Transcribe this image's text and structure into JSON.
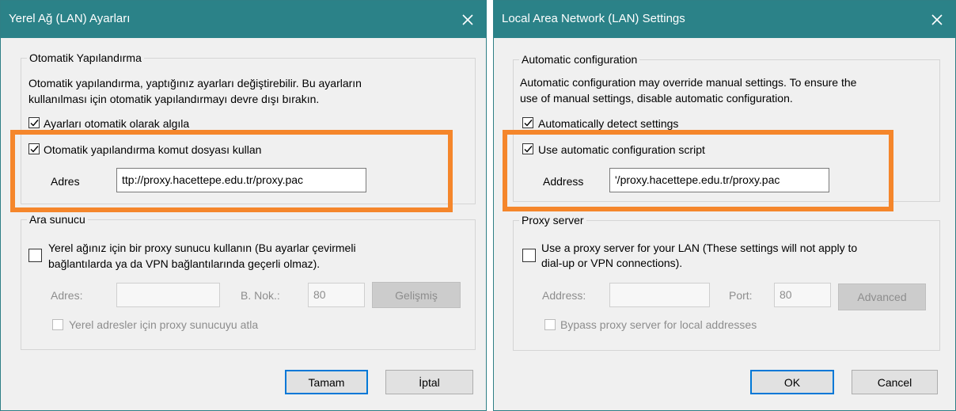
{
  "colors": {
    "titlebar": "#2b8288",
    "highlight": "#f5862b",
    "primary_border": "#0078d7"
  },
  "dialog_tr": {
    "title": "Yerel Ağ (LAN) Ayarları",
    "auto_config": {
      "legend": "Otomatik Yapılandırma",
      "description_line1": "Otomatik yapılandırma, yaptığınız ayarları değiştirebilir. Bu ayarların",
      "description_line2": "kullanılması için otomatik yapılandırmayı devre dışı bırakın.",
      "detect_label": "Ayarları otomatik olarak algıla",
      "detect_checked": true,
      "script_label": "Otomatik yapılandırma komut dosyası kullan",
      "script_checked": true,
      "address_label": "Adres",
      "address_value": "ttp://proxy.hacettepe.edu.tr/proxy.pac"
    },
    "proxy": {
      "legend": "Ara sunucu",
      "use_proxy_line1": "Yerel ağınız için bir proxy sunucu kullanın (Bu ayarlar çevirmeli",
      "use_proxy_line2": "bağlantılarda ya da VPN bağlantılarında geçerli olmaz).",
      "use_proxy_checked": false,
      "address_label": "Adres:",
      "address_value": "",
      "port_label": "B. Nok.:",
      "port_value": "80",
      "advanced_label": "Gelişmiş",
      "bypass_label": "Yerel adresler için proxy sunucuyu atla",
      "bypass_checked": false
    },
    "ok_label": "Tamam",
    "cancel_label": "İptal"
  },
  "dialog_en": {
    "title": "Local Area Network (LAN) Settings",
    "auto_config": {
      "legend": "Automatic configuration",
      "description_line1": "Automatic configuration may override manual settings.  To ensure the",
      "description_line2": "use of manual settings, disable automatic configuration.",
      "detect_label": "Automatically detect settings",
      "detect_checked": true,
      "script_label": "Use automatic configuration script",
      "script_checked": true,
      "address_label": "Address",
      "address_value": "'/proxy.hacettepe.edu.tr/proxy.pac"
    },
    "proxy": {
      "legend": "Proxy server",
      "use_proxy_line1": "Use a proxy server for your LAN (These settings will not apply to",
      "use_proxy_line2": "dial-up or VPN connections).",
      "use_proxy_checked": false,
      "address_label": "Address:",
      "address_value": "",
      "port_label": "Port:",
      "port_value": "80",
      "advanced_label": "Advanced",
      "bypass_label": "Bypass proxy server for local addresses",
      "bypass_checked": false
    },
    "ok_label": "OK",
    "cancel_label": "Cancel"
  }
}
